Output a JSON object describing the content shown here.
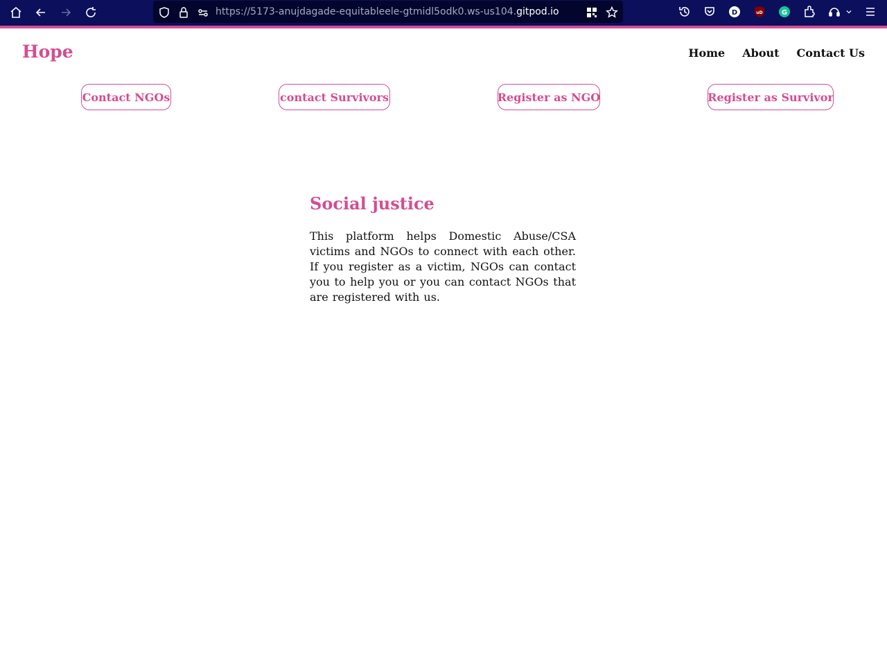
{
  "browser": {
    "url_prefix": "https://5173-anujdagade-equitableele-gtmidl5odk0.ws-us104.",
    "url_host": "gitpod.io",
    "accent_color": "#d44d92",
    "toolbar_color": "#0b0f5c",
    "icons": [
      "home-icon",
      "back-icon",
      "forward-icon",
      "reload-icon",
      "shield-icon",
      "lock-icon",
      "permissions-icon",
      "qr-code-icon",
      "bookmark-star-icon",
      "history-icon",
      "pocket-icon",
      "profile-d-icon",
      "ublock-icon",
      "grammarly-icon",
      "extensions-icon",
      "sync-icon",
      "chevron-down-icon",
      "menu-icon"
    ],
    "profile_letter": "D",
    "ublock_label": "uD",
    "grammarly_letter": "G"
  },
  "site": {
    "logo": "Hope",
    "nav": [
      "Home",
      "About",
      "Contact Us"
    ],
    "actions": [
      "Contact NGOs",
      "contact Survivors",
      "Register as NGO",
      "Register as Survivor"
    ],
    "hero_title": "Social justice",
    "hero_text": "This platform helps Domestic Abuse/CSA victims and NGOs to connect with each other. If you register as a victim, NGOs can contact you to help you or you can contact NGOs that are registered with us.",
    "brand_color": "#d44d92"
  }
}
